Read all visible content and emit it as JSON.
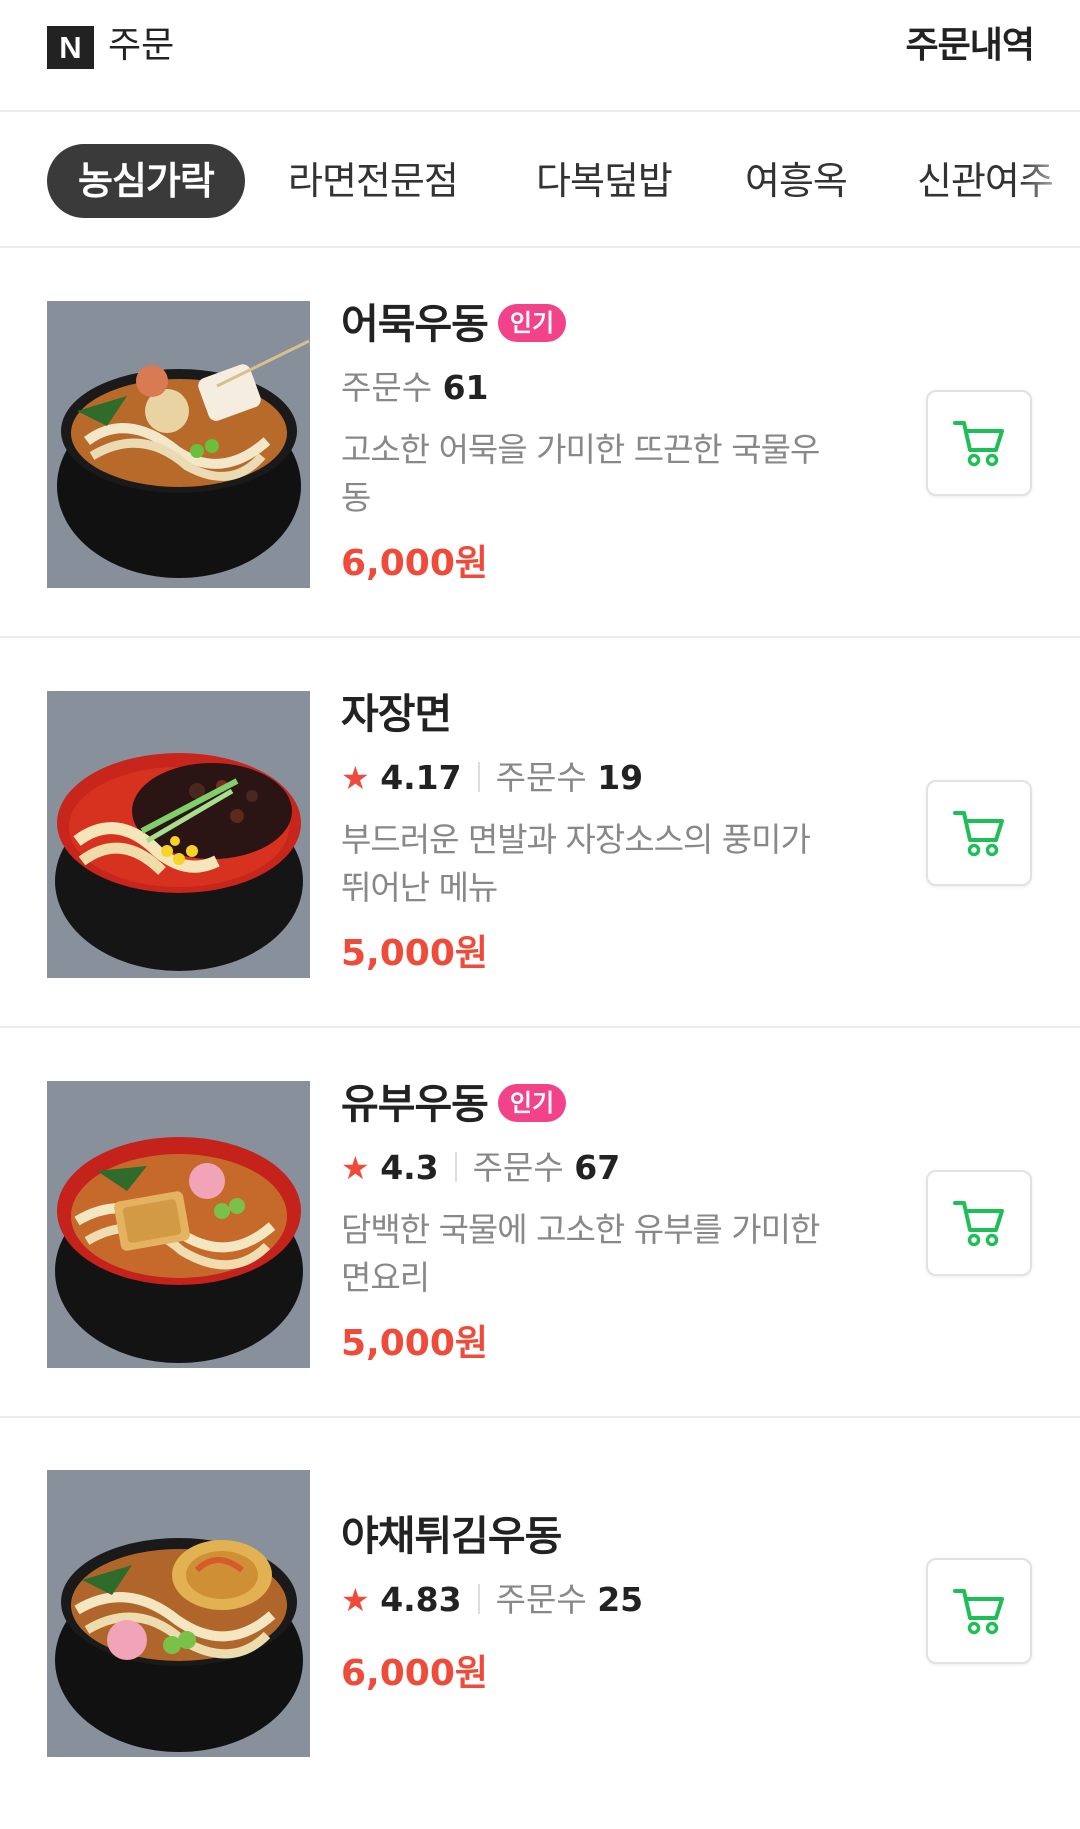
{
  "header": {
    "logo_text": "N",
    "title": "주문",
    "order_history": "주문내역"
  },
  "tabs": [
    {
      "label": "농심가락",
      "active": true
    },
    {
      "label": "라면전문점",
      "active": false
    },
    {
      "label": "다복덮밥",
      "active": false
    },
    {
      "label": "여흥옥",
      "active": false
    },
    {
      "label": "신관여주",
      "active": false
    }
  ],
  "menu_items": [
    {
      "name": "어묵우동",
      "badge": "인기",
      "rating": "",
      "order_count_label": "주문수",
      "order_count": "61",
      "description_line1": "고소한 어묵을 가미한 뜨끈한 국물우",
      "description_line2": "동",
      "price": "6,000원",
      "bowl_color": "black"
    },
    {
      "name": "자장면",
      "badge": "",
      "rating": "4.17",
      "order_count_label": "주문수",
      "order_count": "19",
      "description_line1": "부드러운 면발과 자장소스의 풍미가",
      "description_line2": "뛰어난 메뉴",
      "price": "5,000원",
      "bowl_color": "red"
    },
    {
      "name": "유부우동",
      "badge": "인기",
      "rating": "4.3",
      "order_count_label": "주문수",
      "order_count": "67",
      "description_line1": "담백한 국물에 고소한 유부를 가미한",
      "description_line2": "면요리",
      "price": "5,000원",
      "bowl_color": "red"
    },
    {
      "name": "야채튀김우동",
      "badge": "",
      "rating": "4.83",
      "order_count_label": "주문수",
      "order_count": "25",
      "description_line1": "",
      "description_line2": "",
      "price": "6,000원",
      "bowl_color": "black"
    }
  ],
  "colors": {
    "accent_price": "#ee4b3a",
    "badge": "#f2428a",
    "cart_icon": "#1fbf58",
    "star": "#f04a3c"
  },
  "icons": {
    "cart": "cart-icon",
    "star": "star-icon"
  },
  "star_glyph": "★"
}
